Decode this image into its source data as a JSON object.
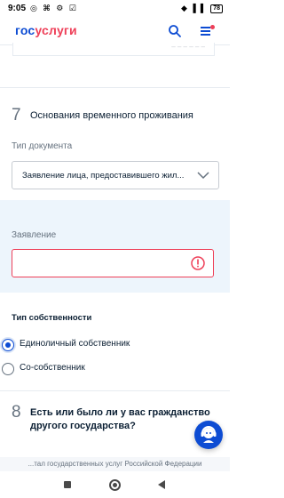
{
  "status_bar": {
    "time": "9:05",
    "left_icons": "◎ ⌘ ⚙ ☑",
    "signal_icons": "◆ ▌▌",
    "battery": "78"
  },
  "header": {
    "logo_blue": "гос",
    "logo_red": "услуги",
    "search_icon": "search-icon",
    "menu_icon": "menu-icon",
    "brand_blue": "#0d4cd3",
    "brand_red": "#ee3f58"
  },
  "section7": {
    "number": "7",
    "title": "Основания временного проживания",
    "doc_type_label": "Тип документа",
    "doc_type_value": "Заявление лица, предоставившего жил...",
    "statement_label": "Заявление",
    "statement_value": ""
  },
  "ownership": {
    "title": "Тип собственности",
    "options": [
      {
        "label": "Единоличный собственник",
        "checked": true
      },
      {
        "label": "Со-собственник",
        "checked": false
      }
    ]
  },
  "section8": {
    "number": "8",
    "title_line1": "Есть или было ли у вас гражданство",
    "title_line2": "другого государства?"
  },
  "footer": {
    "text": "...тал государственных услуг Российской Федерации"
  }
}
